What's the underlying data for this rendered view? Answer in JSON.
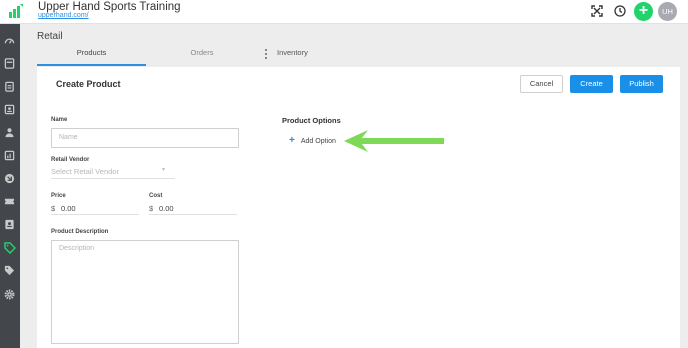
{
  "header": {
    "app_title": "Upper Hand Sports Training",
    "app_url": "upperhand.com/",
    "avatar_initials": "UH",
    "add_symbol": "+"
  },
  "page": {
    "section_title": "Retail"
  },
  "tabs": [
    {
      "label": "Products",
      "active": true
    },
    {
      "label": "Orders",
      "active": false
    },
    {
      "label": "Inventory",
      "active": false
    }
  ],
  "form": {
    "title": "Create Product",
    "cancel_label": "Cancel",
    "create_label": "Create",
    "publish_label": "Publish",
    "name_label": "Name",
    "name_placeholder": "Name",
    "vendor_label": "Retail Vendor",
    "vendor_placeholder": "Select Retail Vendor",
    "price_label": "Price",
    "price_prefix": "$",
    "price_value": "0.00",
    "cost_label": "Cost",
    "cost_prefix": "$",
    "cost_value": "0.00",
    "description_label": "Product Description",
    "description_placeholder": "Description",
    "options_title": "Product Options",
    "add_option_label": "Add Option"
  },
  "colors": {
    "accent": "#1a8fe8",
    "green": "#20d36b",
    "arrow": "#7ed957",
    "sidebar": "#43464b",
    "sidebar_active": "#20d36b"
  },
  "sidebar_icons": [
    "dashboard-icon",
    "calendar-icon",
    "clipboard-icon",
    "contacts-icon",
    "users-icon",
    "reports-icon",
    "marketing-icon",
    "tickets-icon",
    "id-card-icon",
    "retail-tag-icon",
    "tags-icon",
    "settings-gear-icon"
  ]
}
